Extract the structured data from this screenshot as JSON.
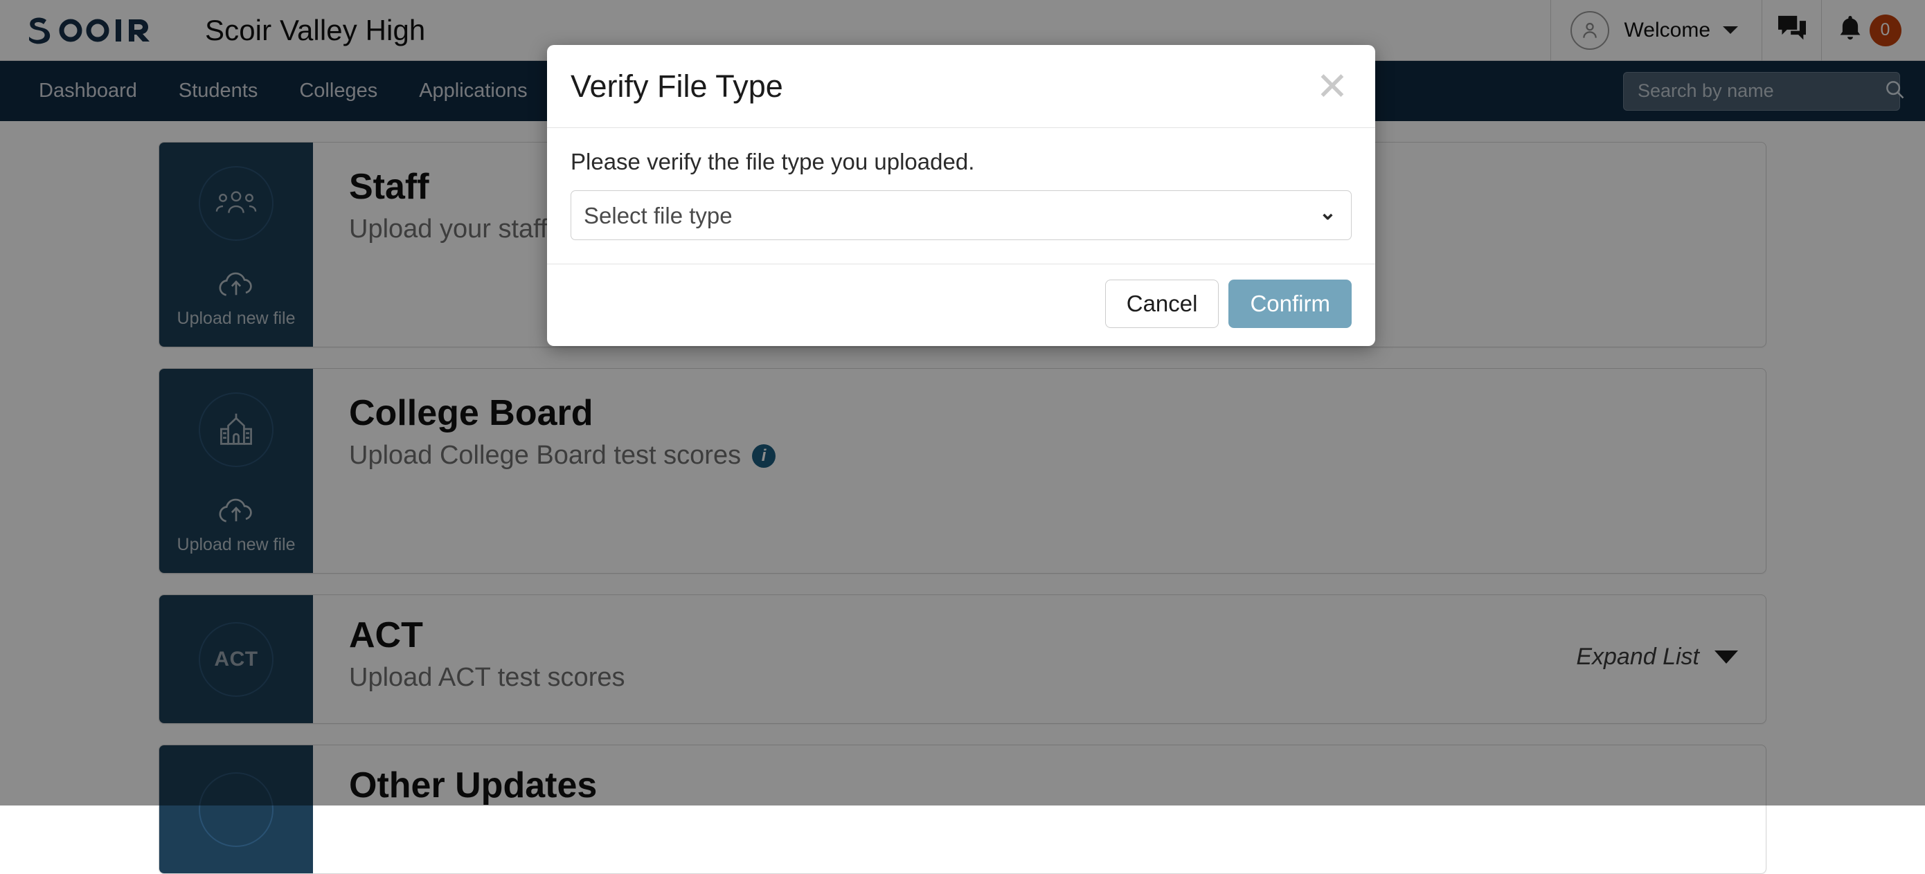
{
  "brand": {
    "logo_text": "SCOIR",
    "school_name": "Scoir Valley High",
    "welcome_label": "Welcome",
    "notifications_count": "0",
    "avatar_icon": "user-avatar-icon",
    "messages_icon": "chat-bubbles-icon",
    "bell_icon": "bell-icon",
    "caret_icon": "chevron-down-icon"
  },
  "nav": {
    "items": [
      {
        "label": "Dashboard"
      },
      {
        "label": "Students"
      },
      {
        "label": "Colleges"
      },
      {
        "label": "Applications"
      }
    ],
    "search": {
      "placeholder": "Search by name",
      "value": "",
      "icon": "search-icon"
    }
  },
  "cards": [
    {
      "title": "Staff",
      "subtitle": "Upload your staff",
      "emblem_icon": "people-group-icon",
      "emblem_text": "",
      "upload_label": "Upload new file",
      "upload_icon": "cloud-upload-icon",
      "has_info": false,
      "expand_label": "",
      "show_expand": false
    },
    {
      "title": "College Board",
      "subtitle": "Upload College Board test scores",
      "emblem_icon": "school-building-icon",
      "emblem_text": "",
      "upload_label": "Upload new file",
      "upload_icon": "cloud-upload-icon",
      "has_info": true,
      "info_icon": "info-icon",
      "expand_label": "",
      "show_expand": false
    },
    {
      "title": "ACT",
      "subtitle": "Upload ACT test scores",
      "emblem_icon": "act-badge-icon",
      "emblem_text": "ACT",
      "upload_label": "",
      "upload_icon": "",
      "has_info": false,
      "expand_label": "Expand List",
      "expand_icon": "chevron-down-icon",
      "show_expand": true
    },
    {
      "title": "Other Updates",
      "subtitle": "",
      "emblem_icon": "circle-icon",
      "emblem_text": "",
      "upload_label": "",
      "upload_icon": "",
      "has_info": false,
      "expand_label": "",
      "show_expand": false
    }
  ],
  "modal": {
    "title": "Verify File Type",
    "close_icon": "close-icon",
    "body_text": "Please verify the file type you uploaded.",
    "select": {
      "selected": "Select file type",
      "arrow_icon": "chevron-down-icon"
    },
    "cancel_label": "Cancel",
    "confirm_label": "Confirm"
  },
  "colors": {
    "navy": "#102a43",
    "card_side": "#1d3e56",
    "confirm": "#74a5bc",
    "badge": "#c2410c",
    "info": "#1d5e80"
  }
}
